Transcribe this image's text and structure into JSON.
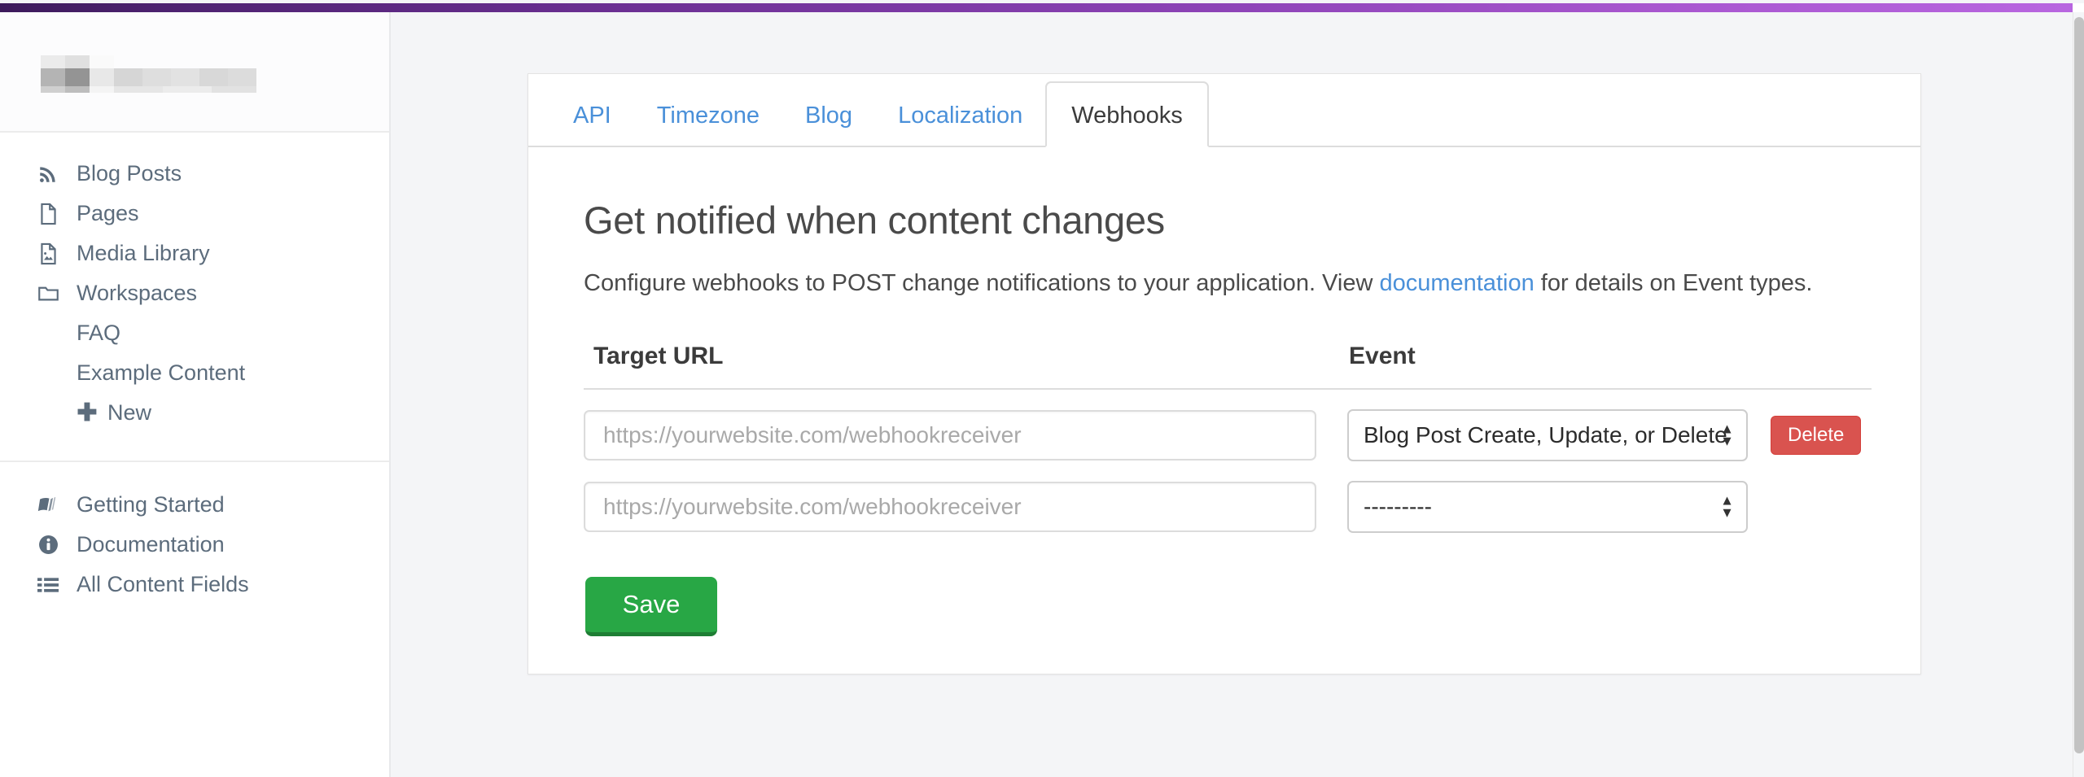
{
  "theme": {
    "accent_gradient_start": "#3c1a5b",
    "accent_gradient_end": "#b866e0",
    "link_color": "#4a90d9",
    "save_button_color": "#28a745",
    "delete_button_color": "#d9534f",
    "main_background": "#f4f5f7"
  },
  "sidebar": {
    "logo_alt": "redacted-logo",
    "primary_items": [
      {
        "label": "Blog Posts",
        "icon": "rss-icon"
      },
      {
        "label": "Pages",
        "icon": "document-icon"
      },
      {
        "label": "Media Library",
        "icon": "image-document-icon"
      },
      {
        "label": "Workspaces",
        "icon": "folder-icon"
      }
    ],
    "workspace_children": [
      {
        "label": "FAQ"
      },
      {
        "label": "Example Content"
      }
    ],
    "new_item": {
      "label": "New",
      "icon": "plus-icon"
    },
    "bottom_items": [
      {
        "label": "Getting Started",
        "icon": "book-icon"
      },
      {
        "label": "Documentation",
        "icon": "info-circle-icon"
      },
      {
        "label": "All Content Fields",
        "icon": "list-icon"
      }
    ]
  },
  "tabs": [
    {
      "label": "API",
      "active": false
    },
    {
      "label": "Timezone",
      "active": false
    },
    {
      "label": "Blog",
      "active": false
    },
    {
      "label": "Localization",
      "active": false
    },
    {
      "label": "Webhooks",
      "active": true
    }
  ],
  "main": {
    "title": "Get notified when content changes",
    "description_before_link": "Configure webhooks to POST change notifications to your application. View ",
    "description_link": "documentation",
    "description_after_link": " for details on Event types.",
    "table": {
      "headers": {
        "url": "Target URL",
        "event": "Event"
      },
      "rows": [
        {
          "url_value": "",
          "url_placeholder": "https://yourwebsite.com/webhookreceiver",
          "event_value": "Blog Post Create, Update, or Delete",
          "has_delete": true,
          "delete_label": "Delete"
        },
        {
          "url_value": "",
          "url_placeholder": "https://yourwebsite.com/webhookreceiver",
          "event_value": "---------",
          "has_delete": false,
          "delete_label": ""
        }
      ]
    },
    "save_label": "Save"
  }
}
